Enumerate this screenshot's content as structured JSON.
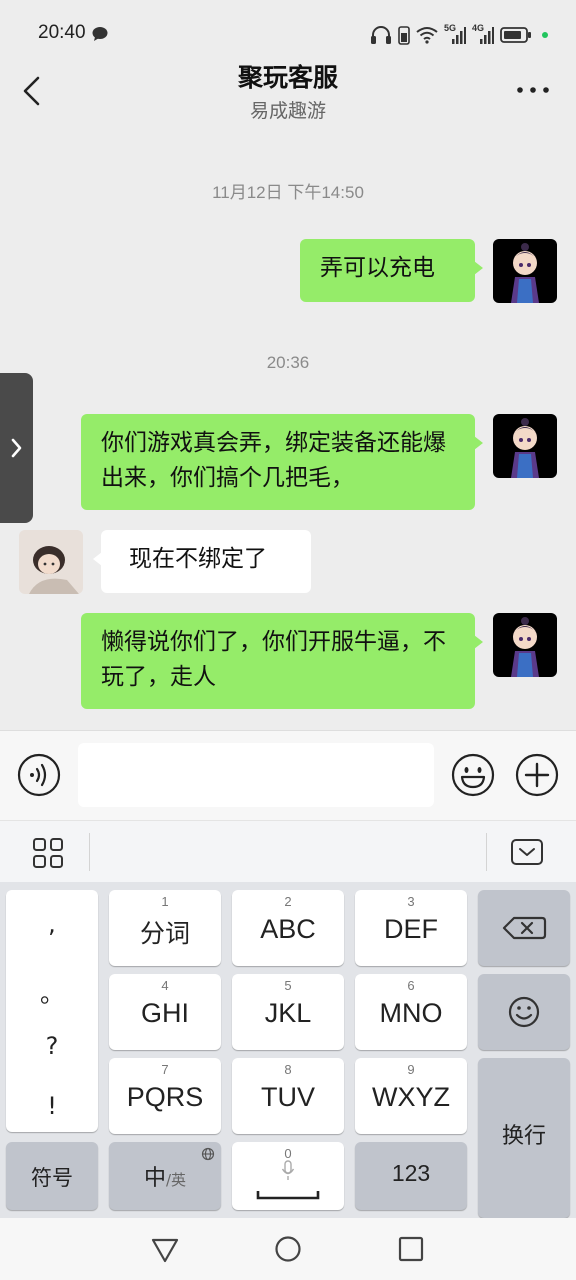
{
  "status_bar": {
    "time": "20:40",
    "net1": "5G",
    "net2": "4G"
  },
  "header": {
    "title": "聚玩客服",
    "subtitle": "易成趣游"
  },
  "chat": {
    "timestamp1": "11月12日 下午14:50",
    "timestamp2": "20:36",
    "messages": [
      {
        "sender": "me",
        "text": "弄可以充电"
      },
      {
        "sender": "me",
        "text": "你们游戏真会弄，绑定装备还能爆出来，你们搞个几把毛，"
      },
      {
        "sender": "other",
        "text": "现在不绑定了"
      },
      {
        "sender": "me",
        "text": "懒得说你们了，你们开服牛逼，不玩了，走人"
      }
    ]
  },
  "input": {
    "value": "",
    "placeholder": ""
  },
  "keyboard": {
    "punct": [
      ",",
      "。",
      "?",
      "!"
    ],
    "row1": [
      {
        "num": "1",
        "label": "分词"
      },
      {
        "num": "2",
        "label": "ABC"
      },
      {
        "num": "3",
        "label": "DEF"
      }
    ],
    "row2": [
      {
        "num": "4",
        "label": "GHI"
      },
      {
        "num": "5",
        "label": "JKL"
      },
      {
        "num": "6",
        "label": "MNO"
      }
    ],
    "row3": [
      {
        "num": "7",
        "label": "PQRS"
      },
      {
        "num": "8",
        "label": "TUV"
      },
      {
        "num": "9",
        "label": "WXYZ"
      }
    ],
    "enter_label": "换行",
    "symbol_label": "符号",
    "lang_main": "中",
    "lang_sub": "/英",
    "space_num": "0",
    "num_label": "123"
  },
  "colors": {
    "my_bubble": "#95ec69",
    "other_bubble": "#ffffff",
    "background": "#ededed"
  }
}
